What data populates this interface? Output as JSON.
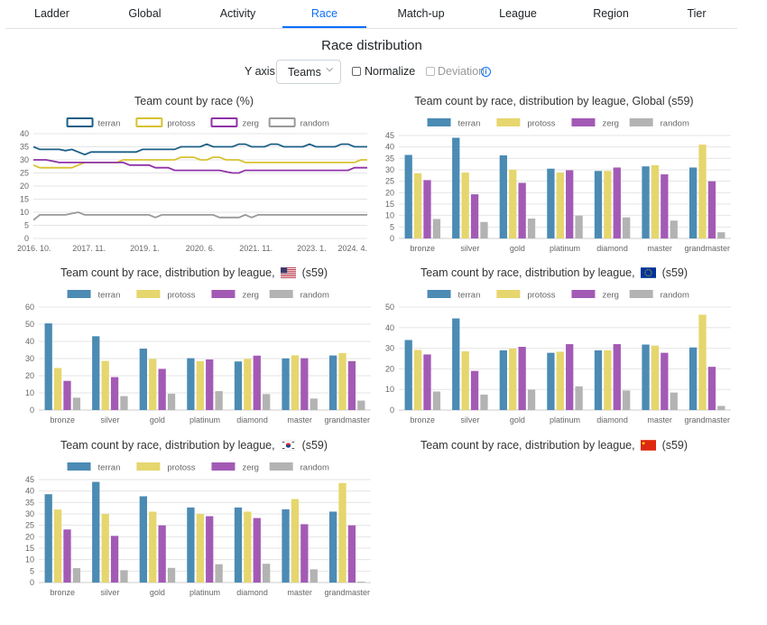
{
  "tabs": [
    "Ladder",
    "Global",
    "Activity",
    "Race",
    "Match-up",
    "League",
    "Region",
    "Tier"
  ],
  "active_tab": "Race",
  "page_title": "Race distribution",
  "controls": {
    "y_axis_label": "Y axis",
    "y_axis_value": "Teams",
    "normalize_label": "Normalize",
    "deviation_label": "Deviation",
    "info_icon": "i"
  },
  "colors": {
    "terran": "#4b8bb4",
    "protoss": "#e6d66e",
    "zerg": "#a35ab5",
    "random": "#b3b3b3"
  },
  "line_colors": {
    "terran": "#1c5f87",
    "protoss": "#d8c230",
    "zerg": "#8f32a8",
    "random": "#999999"
  },
  "legend": [
    "terran",
    "protoss",
    "zerg",
    "random"
  ],
  "charts": {
    "timeline": {
      "title": "Team count by race (%)"
    },
    "global": {
      "title": "Team count by race, distribution by league, Global (s59)"
    },
    "us": {
      "title_prefix": "Team count by race, distribution by league,",
      "title_suffix": "(s59)",
      "flag": "us-flag-icon"
    },
    "eu": {
      "title_prefix": "Team count by race, distribution by league,",
      "title_suffix": "(s59)",
      "flag": "eu-flag-icon"
    },
    "kr": {
      "title_prefix": "Team count by race, distribution by league,",
      "title_suffix": "(s59)",
      "flag": "kr-flag-icon"
    },
    "cn": {
      "title_prefix": "Team count by race, distribution by league,",
      "title_suffix": "(s59)",
      "flag": "cn-flag-icon"
    }
  },
  "chart_data": [
    {
      "id": "timeline",
      "type": "line",
      "ylim": [
        0,
        40
      ],
      "yticks": [
        0,
        5,
        10,
        15,
        20,
        25,
        30,
        35,
        40
      ],
      "x_tick_labels": [
        "2016. 10.",
        "2017. 11.",
        "2019. 1.",
        "2020. 6.",
        "2021. 11.",
        "2023. 1.",
        "2024. 4."
      ],
      "series": [
        {
          "name": "terran",
          "values": [
            35,
            34,
            34,
            34,
            34,
            33.5,
            34,
            33,
            32,
            33,
            33,
            33,
            33,
            33,
            33,
            33,
            33,
            34,
            34,
            34,
            34,
            34,
            34,
            35,
            35,
            35,
            35,
            36,
            35,
            35,
            35,
            35,
            36,
            36,
            35,
            35,
            35,
            36,
            36,
            35,
            35,
            35,
            35,
            36,
            35,
            35,
            35,
            35,
            36,
            36,
            35,
            35,
            35
          ]
        },
        {
          "name": "protoss",
          "values": [
            28,
            27,
            27,
            27,
            27,
            27,
            27,
            28,
            29,
            29,
            29,
            29,
            29,
            29,
            30,
            30,
            30,
            30,
            30,
            30,
            30,
            30,
            30,
            31,
            31,
            31,
            30,
            30,
            31,
            31,
            30,
            30,
            30,
            29,
            29,
            29,
            29,
            29,
            29,
            29,
            29,
            29,
            29,
            29,
            29,
            29,
            29,
            29,
            29,
            29,
            29,
            30,
            30
          ]
        },
        {
          "name": "zerg",
          "values": [
            30,
            30,
            30,
            29.5,
            29,
            29,
            29,
            29,
            29,
            29,
            29,
            29,
            29,
            29,
            29,
            28,
            28,
            28,
            28,
            27,
            27,
            27,
            26,
            26,
            26,
            26,
            26,
            26,
            26,
            26,
            25.5,
            25,
            25,
            26,
            26,
            26,
            26,
            26,
            26,
            26,
            26,
            26,
            26,
            26,
            26,
            26,
            26,
            26,
            26,
            26,
            27,
            27,
            27
          ]
        },
        {
          "name": "random",
          "values": [
            7,
            9,
            9,
            9,
            9,
            9,
            9.5,
            10,
            9,
            9,
            9,
            9,
            9,
            9,
            9,
            9,
            9,
            9,
            9,
            8,
            9,
            9,
            9,
            9,
            9,
            9,
            9,
            9,
            9,
            8,
            8,
            8,
            8,
            9,
            8,
            9,
            9,
            9,
            9,
            9,
            9,
            9,
            9,
            9,
            9,
            9,
            9,
            9,
            9,
            9,
            9,
            9,
            9
          ]
        }
      ]
    },
    {
      "id": "global",
      "type": "bar",
      "ylim": [
        0,
        45
      ],
      "yticks": [
        0,
        5,
        10,
        15,
        20,
        25,
        30,
        35,
        40,
        45
      ],
      "categories": [
        "bronze",
        "silver",
        "gold",
        "platinum",
        "diamond",
        "master",
        "grandmaster"
      ],
      "series": [
        {
          "name": "terran",
          "values": [
            36.5,
            44,
            36.3,
            30.5,
            29.5,
            31.5,
            31
          ]
        },
        {
          "name": "protoss",
          "values": [
            28.5,
            28.8,
            30,
            28.8,
            29.5,
            32,
            41
          ]
        },
        {
          "name": "zerg",
          "values": [
            25.5,
            19.3,
            24.3,
            29.8,
            31,
            28,
            25
          ]
        },
        {
          "name": "random",
          "values": [
            8.5,
            7.2,
            8.7,
            10,
            9.2,
            7.8,
            2.7
          ]
        }
      ]
    },
    {
      "id": "us",
      "type": "bar",
      "ylim": [
        0,
        60
      ],
      "yticks": [
        0,
        10,
        20,
        30,
        40,
        50,
        60
      ],
      "categories": [
        "bronze",
        "silver",
        "gold",
        "platinum",
        "diamond",
        "master",
        "grandmaster"
      ],
      "series": [
        {
          "name": "terran",
          "values": [
            50.5,
            43,
            35.8,
            30.2,
            28.3,
            30.1,
            31.8
          ]
        },
        {
          "name": "protoss",
          "values": [
            24.5,
            28.6,
            29.8,
            28.5,
            29.8,
            31.9,
            33.2
          ]
        },
        {
          "name": "zerg",
          "values": [
            17,
            19.2,
            24,
            29.5,
            31.7,
            30.2,
            28.5
          ]
        },
        {
          "name": "random",
          "values": [
            7.2,
            8.1,
            9.5,
            11,
            9.3,
            6.7,
            5.5
          ]
        }
      ]
    },
    {
      "id": "eu",
      "type": "bar",
      "ylim": [
        0,
        50
      ],
      "yticks": [
        0,
        10,
        20,
        30,
        40,
        50
      ],
      "categories": [
        "bronze",
        "silver",
        "gold",
        "platinum",
        "diamond",
        "master",
        "grandmaster"
      ],
      "series": [
        {
          "name": "terran",
          "values": [
            34,
            44.5,
            29,
            27.8,
            29,
            31.8,
            30.4
          ]
        },
        {
          "name": "protoss",
          "values": [
            29.2,
            28.5,
            29.8,
            28.3,
            29,
            31.3,
            46.3
          ]
        },
        {
          "name": "zerg",
          "values": [
            27,
            19,
            30.7,
            32,
            32,
            27.8,
            21
          ]
        },
        {
          "name": "random",
          "values": [
            9,
            7.5,
            9.9,
            11.5,
            9.5,
            8.5,
            2
          ]
        }
      ]
    },
    {
      "id": "kr",
      "type": "bar",
      "ylim": [
        0,
        45
      ],
      "yticks": [
        0,
        5,
        10,
        15,
        20,
        25,
        30,
        35,
        40,
        45
      ],
      "categories": [
        "bronze",
        "silver",
        "gold",
        "platinum",
        "diamond",
        "master",
        "grandmaster"
      ],
      "series": [
        {
          "name": "terran",
          "values": [
            38.6,
            44,
            37.7,
            32.8,
            32.8,
            32,
            31
          ]
        },
        {
          "name": "protoss",
          "values": [
            31.9,
            30,
            31,
            30,
            31,
            36.5,
            43.5
          ]
        },
        {
          "name": "zerg",
          "values": [
            23.2,
            20.4,
            25,
            29,
            28.2,
            25.5,
            25
          ]
        },
        {
          "name": "random",
          "values": [
            6.3,
            5.4,
            6.4,
            8,
            8.2,
            5.8,
            0.4
          ]
        }
      ]
    }
  ]
}
